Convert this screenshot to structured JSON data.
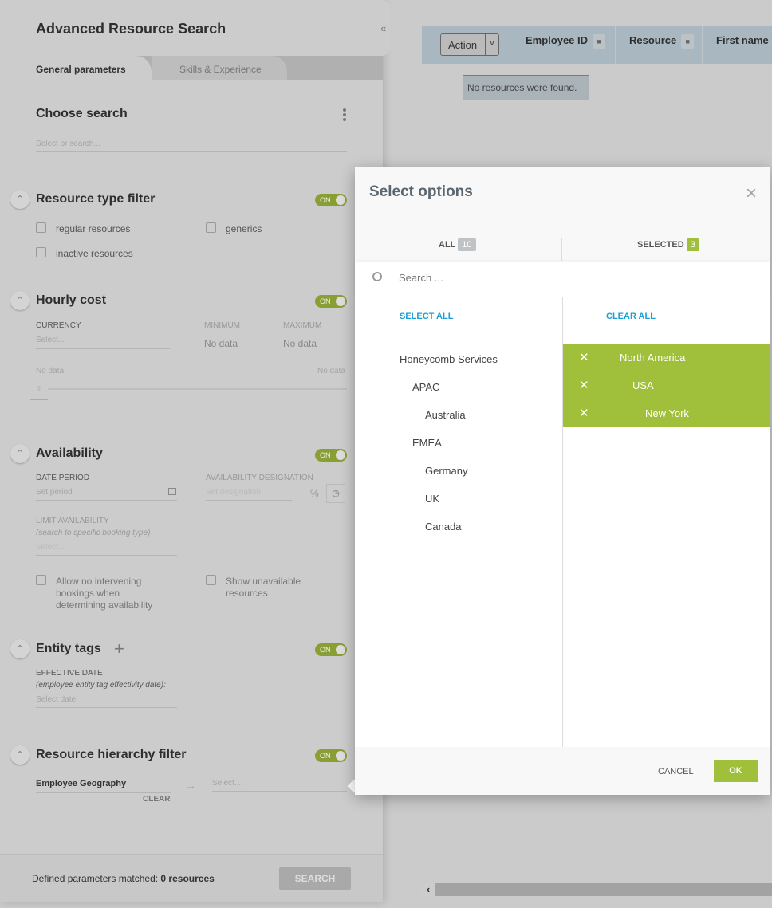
{
  "panel": {
    "title": "Advanced Resource Search",
    "collapse_icon": "«",
    "tabs": [
      {
        "label": "General parameters",
        "active": true
      },
      {
        "label": "Skills & Experience",
        "active": false
      }
    ],
    "choose_search": {
      "title": "Choose search",
      "placeholder": "Select or search..."
    },
    "resource_type": {
      "title": "Resource type filter",
      "toggle": "ON",
      "options": [
        "regular resources",
        "generics",
        "inactive resources"
      ]
    },
    "hourly_cost": {
      "title": "Hourly cost",
      "toggle": "ON",
      "currency_label": "CURRENCY",
      "currency_placeholder": "Select...",
      "min_label": "MINIMUM",
      "max_label": "MAXIMUM",
      "min_value": "No data",
      "max_value": "No data",
      "range_min": "No data",
      "range_max": "No data",
      "slider_handle": "III"
    },
    "availability": {
      "title": "Availability",
      "toggle": "ON",
      "date_label": "DATE PERIOD",
      "date_placeholder": "Set period",
      "designation_label": "AVAILABILITY DESIGNATION",
      "designation_placeholder": "Set designation",
      "percent": "%",
      "limit_label": "LIMIT AVAILABILITY",
      "limit_hint": "(search to specific booking type)",
      "limit_placeholder": "Select...",
      "checkbox1": "Allow no intervening bookings when determining availability",
      "checkbox2": "Show unavailable resources"
    },
    "entity_tags": {
      "title": "Entity tags",
      "add": "+",
      "toggle": "ON",
      "date_label": "EFFECTIVE DATE",
      "date_hint": "(employee entity tag effectivity date):",
      "date_placeholder": "Select date"
    },
    "hierarchy": {
      "title": "Resource hierarchy filter",
      "toggle": "ON",
      "selected": "Employee Geography",
      "clear": "CLEAR",
      "arrow": "→",
      "target_placeholder": "Select..."
    },
    "footer": {
      "text": "Defined parameters matched: ",
      "count": "0 resources",
      "search": "SEARCH"
    }
  },
  "grid": {
    "action": "Action",
    "columns": [
      "Employee ID",
      "Resource",
      "First name"
    ],
    "empty": "No resources were found.",
    "scroll_left": "‹"
  },
  "modal": {
    "title": "Select options",
    "close": "×",
    "all_label": "ALL",
    "all_count": "10",
    "selected_label": "SELECTED",
    "selected_count": "3",
    "search_placeholder": "Search ...",
    "select_all": "SELECT ALL",
    "clear_all": "CLEAR ALL",
    "options": [
      {
        "label": "Honeycomb Services",
        "level": 0
      },
      {
        "label": "APAC",
        "level": 1
      },
      {
        "label": "Australia",
        "level": 2
      },
      {
        "label": "EMEA",
        "level": 1
      },
      {
        "label": "Germany",
        "level": 2
      },
      {
        "label": "UK",
        "level": 2
      },
      {
        "label": "Canada",
        "level": 2
      }
    ],
    "selected": [
      {
        "label": "North America",
        "level": 0
      },
      {
        "label": "USA",
        "level": 1
      },
      {
        "label": "New York",
        "level": 2
      }
    ],
    "cancel": "CANCEL",
    "ok": "OK"
  },
  "colors": {
    "accent_green": "#a0bf3a",
    "link_blue": "#1a9fd6",
    "grid_header": "#a9b8c0"
  }
}
